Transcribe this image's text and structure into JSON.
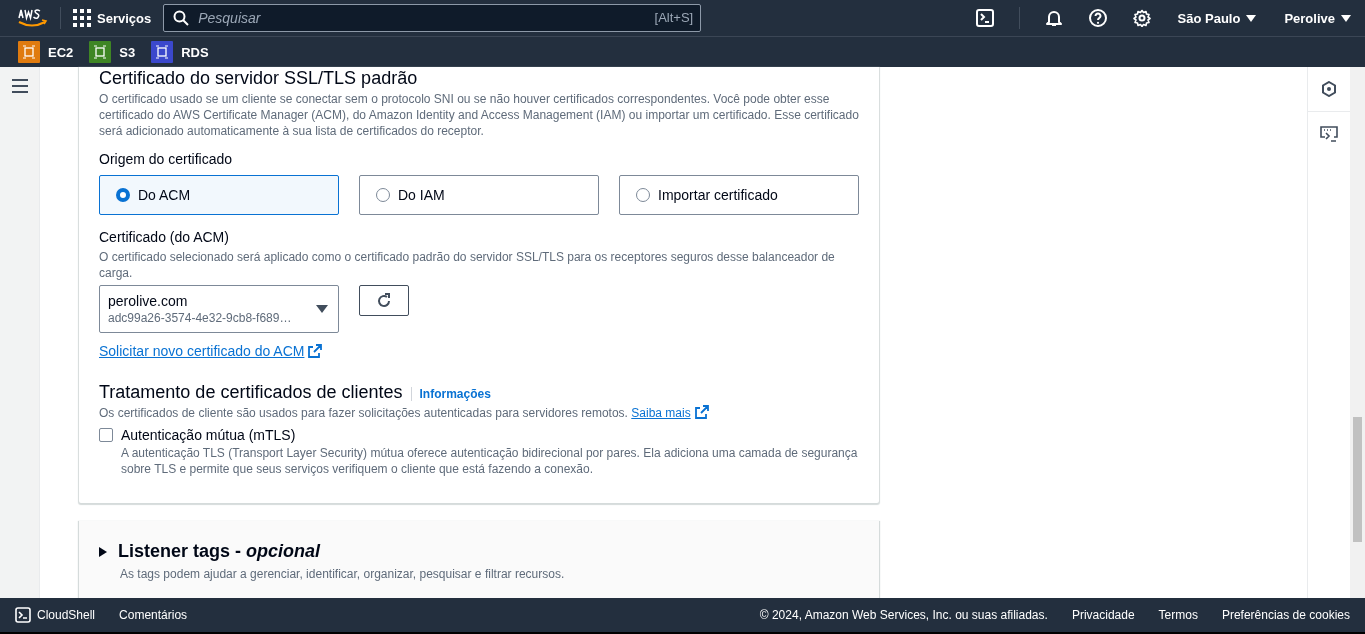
{
  "header": {
    "services_label": "Serviços",
    "search": {
      "placeholder": "Pesquisar",
      "shortcut": "[Alt+S]"
    },
    "region": "São Paulo",
    "account": "Perolive"
  },
  "favorites": [
    {
      "label": "EC2",
      "color": "#e07b0f"
    },
    {
      "label": "S3",
      "color": "#3f8624"
    },
    {
      "label": "RDS",
      "color": "#3b48cc"
    }
  ],
  "certificate_section": {
    "title": "Certificado do servidor SSL/TLS padrão",
    "description": "O certificado usado se um cliente se conectar sem o protocolo SNI ou se não houver certificados correspondentes. Você pode obter esse certificado do AWS Certificate Manager (ACM), do Amazon Identity and Access Management (IAM) ou importar um certificado. Esse certificado será adicionado automaticamente à sua lista de certificados do receptor.",
    "source_label": "Origem do certificado",
    "source_options": [
      {
        "label": "Do ACM",
        "selected": true
      },
      {
        "label": "Do IAM",
        "selected": false
      },
      {
        "label": "Importar certificado",
        "selected": false
      }
    ],
    "certificate_label": "Certificado (do ACM)",
    "certificate_description": "O certificado selecionado será aplicado como o certificado padrão do servidor SSL/TLS para os receptores seguros desse balanceador de carga.",
    "select": {
      "value": "perolive.com",
      "detail": "adc99a26-3574-4e32-9cb8-f689…"
    },
    "request_link": "Solicitar novo certificado do ACM"
  },
  "client_cert_section": {
    "title": "Tratamento de certificados de clientes",
    "info_link": "Informações",
    "description": "Os certificados de cliente são usados para fazer solicitações autenticadas para servidores remotos.",
    "learn_more": "Saiba mais",
    "mtls": {
      "label": "Autenticação mútua (mTLS)",
      "checked": false,
      "description": "A autenticação TLS (Transport Layer Security) mútua oferece autenticação bidirecional por pares. Ela adiciona uma camada de segurança sobre TLS e permite que seus serviços verifiquem o cliente que está fazendo a conexão."
    }
  },
  "listener_tags": {
    "title": "Listener tags - *opcional*",
    "expanded": false,
    "description": "As tags podem ajudar a gerenciar, identificar, organizar, pesquisar e filtrar recursos."
  },
  "footer": {
    "cloudshell": "CloudShell",
    "feedback": "Comentários",
    "copyright": "© 2024, Amazon Web Services, Inc. ou suas afiliadas.",
    "links": [
      "Privacidade",
      "Termos",
      "Preferências de cookies"
    ]
  }
}
